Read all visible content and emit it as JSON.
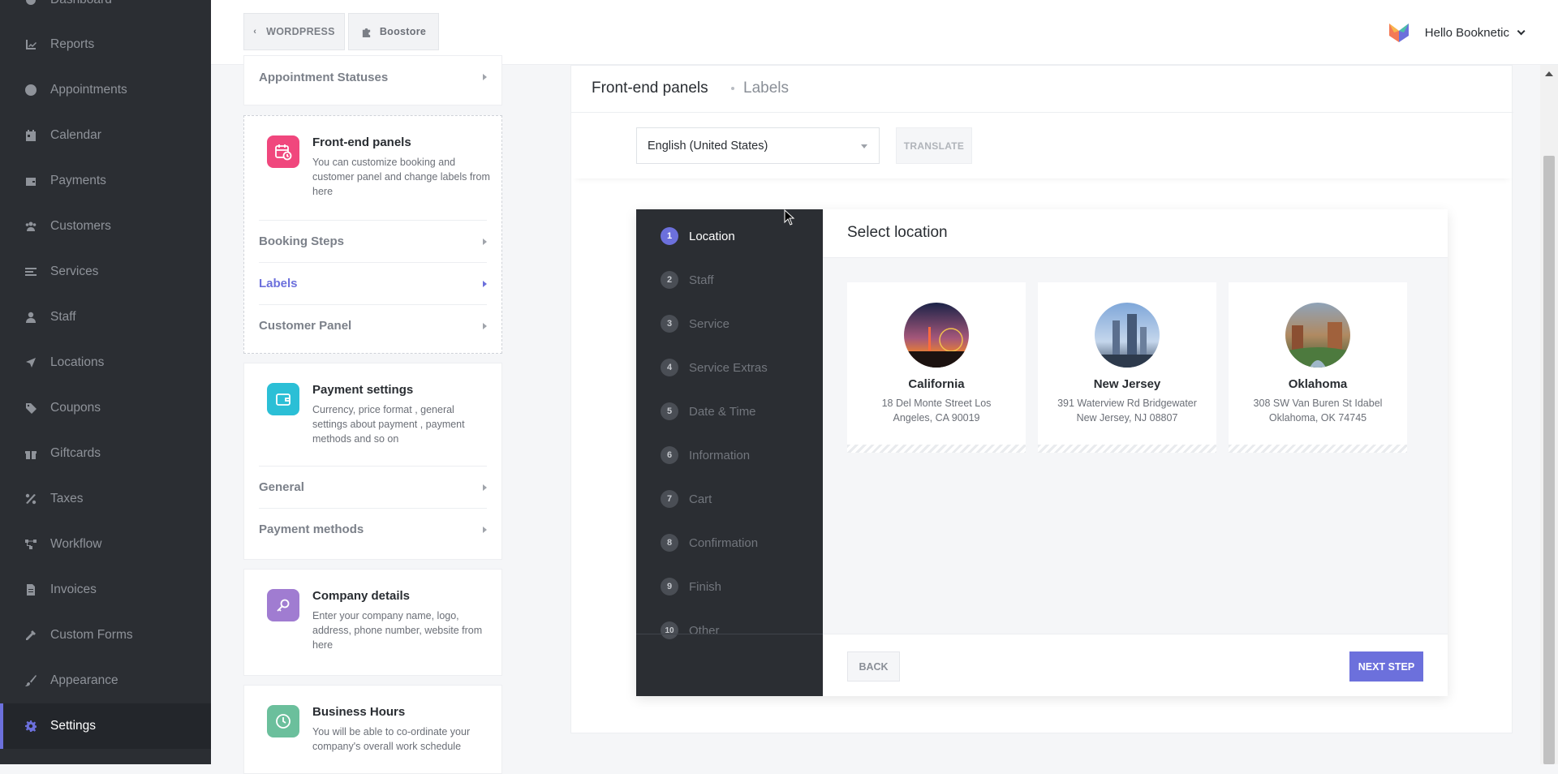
{
  "sidebar": {
    "items": [
      {
        "label": "Dashboard",
        "icon": "dashboard-icon"
      },
      {
        "label": "Reports",
        "icon": "chart-icon"
      },
      {
        "label": "Appointments",
        "icon": "clock-icon"
      },
      {
        "label": "Calendar",
        "icon": "calendar-icon"
      },
      {
        "label": "Payments",
        "icon": "wallet-icon"
      },
      {
        "label": "Customers",
        "icon": "users-icon"
      },
      {
        "label": "Services",
        "icon": "list-icon"
      },
      {
        "label": "Staff",
        "icon": "user-icon"
      },
      {
        "label": "Locations",
        "icon": "location-arrow-icon"
      },
      {
        "label": "Coupons",
        "icon": "tag-icon"
      },
      {
        "label": "Giftcards",
        "icon": "gift-icon"
      },
      {
        "label": "Taxes",
        "icon": "percent-icon"
      },
      {
        "label": "Workflow",
        "icon": "workflow-icon"
      },
      {
        "label": "Invoices",
        "icon": "file-icon"
      },
      {
        "label": "Custom Forms",
        "icon": "tools-icon"
      },
      {
        "label": "Appearance",
        "icon": "brush-icon"
      },
      {
        "label": "Settings",
        "icon": "gear-icon",
        "active": true
      }
    ]
  },
  "topbar": {
    "wp_label": "WORDPRESS",
    "boostore_label": "Boostore",
    "user_greeting": "Hello Booknetic"
  },
  "settings_menu": {
    "appointment_statuses": "Appointment Statuses",
    "frontend": {
      "title": "Front-end panels",
      "desc": "You can customize booking and customer panel and change labels from here",
      "items": [
        "Booking Steps",
        "Labels",
        "Customer Panel"
      ]
    },
    "payment": {
      "title": "Payment settings",
      "desc": "Currency, price format , general settings about payment , payment methods and so on",
      "items": [
        "General",
        "Payment methods"
      ]
    },
    "company": {
      "title": "Company details",
      "desc": "Enter your company name, logo, address, phone number, website from here"
    },
    "business_hours": {
      "title": "Business Hours",
      "desc": "You will be able to co-ordinate your company's overall work schedule"
    }
  },
  "panel": {
    "breadcrumb": [
      "Front-end panels",
      "Labels"
    ],
    "language": "English (United States)",
    "translate_label": "TRANSLATE"
  },
  "booking": {
    "steps": [
      {
        "num": "1",
        "label": "Location"
      },
      {
        "num": "2",
        "label": "Staff"
      },
      {
        "num": "3",
        "label": "Service"
      },
      {
        "num": "4",
        "label": "Service Extras"
      },
      {
        "num": "5",
        "label": "Date & Time"
      },
      {
        "num": "6",
        "label": "Information"
      },
      {
        "num": "7",
        "label": "Cart"
      },
      {
        "num": "8",
        "label": "Confirmation"
      },
      {
        "num": "9",
        "label": "Finish"
      },
      {
        "num": "10",
        "label": "Other"
      }
    ],
    "active_step": 1,
    "title": "Select location",
    "locations": [
      {
        "name": "California",
        "address": "18 Del Monte Street Los Angeles, CA 90019"
      },
      {
        "name": "New Jersey",
        "address": "391 Waterview Rd Bridgewater New Jersey, NJ 08807"
      },
      {
        "name": "Oklahoma",
        "address": "308 SW Van Buren St Idabel Oklahoma, OK 74745"
      }
    ],
    "back_label": "BACK",
    "next_label": "NEXT STEP"
  },
  "colors": {
    "accent": "#6c70dc",
    "sidebar_bg": "#2b2e33"
  }
}
